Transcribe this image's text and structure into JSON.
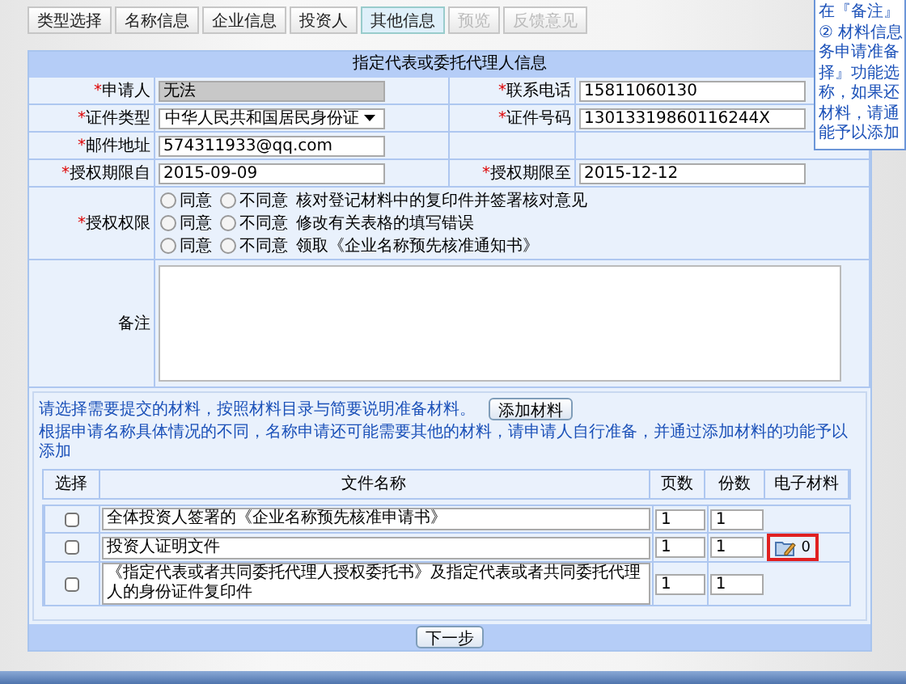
{
  "tabs": [
    {
      "label": "类型选择",
      "selected": false,
      "disabled": false
    },
    {
      "label": "名称信息",
      "selected": false,
      "disabled": false
    },
    {
      "label": "企业信息",
      "selected": false,
      "disabled": false
    },
    {
      "label": "投资人",
      "selected": false,
      "disabled": false
    },
    {
      "label": "其他信息",
      "selected": true,
      "disabled": false
    },
    {
      "label": "预览",
      "selected": false,
      "disabled": true
    },
    {
      "label": "反馈意见",
      "selected": false,
      "disabled": true
    }
  ],
  "tooltip": {
    "lines": [
      "在『备注』",
      "② 材料信息",
      "务申请准备",
      "择』功能选",
      "称，如果还",
      "材料，请通",
      "能予以添加"
    ]
  },
  "form": {
    "title": "指定代表或委托代理人信息",
    "required_mark": "*",
    "rows": [
      {
        "left": {
          "label": "申请人",
          "required": true,
          "kind": "readonly",
          "value": "无法"
        },
        "right": {
          "label": "联系电话",
          "required": true,
          "kind": "text",
          "value": "15811060130"
        }
      },
      {
        "left": {
          "label": "证件类型",
          "required": true,
          "kind": "select",
          "value": "中华人民共和国居民身份证"
        },
        "right": {
          "label": "证件号码",
          "required": true,
          "kind": "text",
          "value": "13013319860116244X"
        }
      },
      {
        "left": {
          "label": "邮件地址",
          "required": true,
          "kind": "text",
          "value": "574311933@qq.com"
        }
      },
      {
        "left": {
          "label": "授权期限自",
          "required": true,
          "kind": "text",
          "value": "2015-09-09"
        },
        "right": {
          "label": "授权期限至",
          "required": true,
          "kind": "text",
          "value": "2015-12-12"
        }
      }
    ],
    "permissions": {
      "label": "授权权限",
      "required": true,
      "options": [
        {
          "choices": [
            {
              "label": "同意",
              "selected": false
            },
            {
              "label": "不同意",
              "selected": false
            }
          ],
          "text": "核对登记材料中的复印件并签署核对意见"
        },
        {
          "choices": [
            {
              "label": "同意",
              "selected": false
            },
            {
              "label": "不同意",
              "selected": false
            }
          ],
          "text": "修改有关表格的填写错误"
        },
        {
          "choices": [
            {
              "label": "同意",
              "selected": false
            },
            {
              "label": "不同意",
              "selected": false
            }
          ],
          "text": "领取《企业名称预先核准通知书》"
        }
      ]
    },
    "remark": {
      "label": "备注"
    }
  },
  "materials": {
    "hint": "请选择需要提交的材料，按照材料目录与简要说明准备材料。",
    "add_button": "添加材料",
    "note": "根据申请名称具体情况的不同，名称申请还可能需要其他的材料，请申请人自行准备，并通过添加材料的功能予以添加",
    "columns": [
      "选择",
      "文件名称",
      "页数",
      "份数",
      "电子材料"
    ],
    "rows": [
      {
        "checked": false,
        "name": "全体投资人签署的《企业名称预先核准申请书》",
        "pages": "1",
        "copies": "1"
      },
      {
        "checked": false,
        "name": "投资人证明文件",
        "pages": "1",
        "copies": "1",
        "attachment": {
          "count": "0",
          "highlighted": true
        }
      },
      {
        "checked": false,
        "name": "《指定代表或者共同委托代理人授权委托书》及指定代表或者共同委托代理人的身份证件复印件",
        "pages": "1",
        "copies": "1"
      }
    ]
  },
  "next_button": "下一步"
}
